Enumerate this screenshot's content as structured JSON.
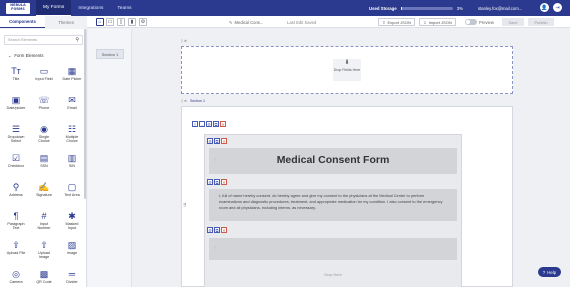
{
  "logo": [
    "NEBULA",
    "FORMS"
  ],
  "nav": {
    "tabs": [
      {
        "label": "My Forms",
        "active": true
      },
      {
        "label": "Integrations",
        "active": false
      },
      {
        "label": "Teams",
        "active": false
      }
    ],
    "storage_label": "Used Storage",
    "storage_percent_text": "3%",
    "storage_percent": 3,
    "user_email": "stanley.fox@mail.com..."
  },
  "subbar": {
    "tabs": [
      {
        "label": "Components",
        "active": true
      },
      {
        "label": "Themes",
        "active": false
      }
    ],
    "form_title": "Medical Cons...",
    "autosave_text": "Last Edit Saved",
    "export_label": "Export JSON",
    "import_label": "Import JSON",
    "preview_label": "Preview",
    "save_label": "Save",
    "publish_label": "Publish"
  },
  "sidebar": {
    "search_placeholder": "Search Elements",
    "section_title": "Form Elements",
    "elements": [
      {
        "label": "Title",
        "icon": "Tт"
      },
      {
        "label": "Input Field",
        "icon": "▭"
      },
      {
        "label": "Date Picker",
        "icon": "▦"
      },
      {
        "label": "Date/picker",
        "icon": "▣"
      },
      {
        "label": "Phone",
        "icon": "☏"
      },
      {
        "label": "Email",
        "icon": "✉"
      },
      {
        "label": "Dropdown Select",
        "icon": "☰"
      },
      {
        "label": "Single Choice",
        "icon": "◉"
      },
      {
        "label": "Multiple Choice",
        "icon": "☷"
      },
      {
        "label": "Checkbox",
        "icon": "☑"
      },
      {
        "label": "SSN",
        "icon": "▤"
      },
      {
        "label": "SIN",
        "icon": "▥"
      },
      {
        "label": "Address",
        "icon": "⚲"
      },
      {
        "label": "Signature",
        "icon": "✍"
      },
      {
        "label": "Text Area",
        "icon": "▢"
      },
      {
        "label": "Paragraph Text",
        "icon": "¶"
      },
      {
        "label": "Input Number",
        "icon": "#"
      },
      {
        "label": "Masked Input",
        "icon": "✱"
      },
      {
        "label": "Upload File",
        "icon": "⇪"
      },
      {
        "label": "Upload Image",
        "icon": "⇧"
      },
      {
        "label": "Image",
        "icon": "▨"
      },
      {
        "label": "Camera",
        "icon": "◎"
      },
      {
        "label": "QR Code",
        "icon": "▩"
      },
      {
        "label": "Divider",
        "icon": "═"
      }
    ]
  },
  "pages": {
    "items": [
      "Section 1"
    ]
  },
  "canvas": {
    "dropzone_label": "Drop Fields Here",
    "section_label": "Section 1",
    "form_title": "Medical Consent Form",
    "paragraph": "I, full of name hereby consent, do hereby agree and give my consent to the physicians at the Medical Center to perform examinations and diagnostic procedures, treatment, and appropriate medication for my condition. I also consent to the emergency room and all physicians, including interns, as necessary.",
    "drop_here": "Drop Here"
  },
  "help_label": "Help",
  "colors": {
    "brand": "#2b3a8e",
    "accent_red": "#d05a4a"
  }
}
